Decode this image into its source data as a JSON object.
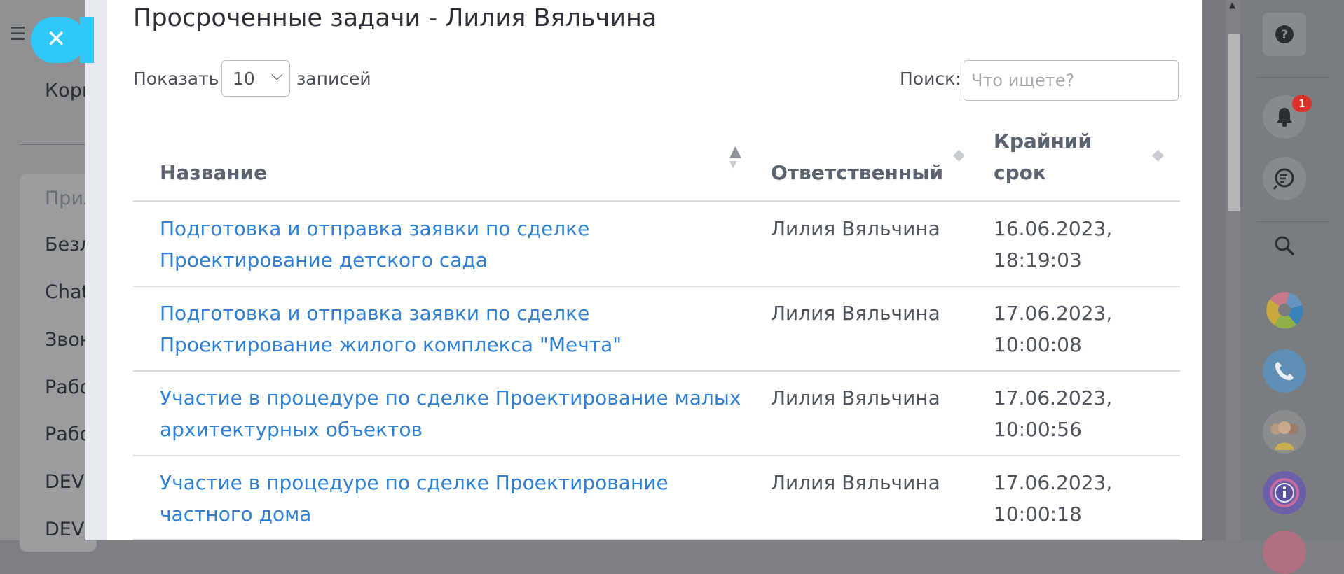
{
  "background": {
    "items": [
      "Корп",
      "Прил",
      "Безл",
      "Chat",
      "Звон",
      "Рабо",
      "Рабо",
      "DEV",
      "DEV"
    ]
  },
  "modal": {
    "title": "Просроченные задачи - Лилия Вяльчина",
    "length": {
      "prefix": "Показать",
      "value": "10",
      "suffix": "записей"
    },
    "search": {
      "label": "Поиск:",
      "placeholder": "Что ищете?"
    },
    "columns": [
      {
        "label": "Название"
      },
      {
        "label": "Ответственный"
      },
      {
        "label_line1": "Крайний",
        "label_line2": "срок"
      }
    ],
    "rows": [
      {
        "name_line1": "Подготовка и отправка заявки по сделке",
        "name_line2": "Проектирование детского сада",
        "responsible": "Лилия Вяльчина",
        "date": "16.06.2023,",
        "time": "18:19:03"
      },
      {
        "name_line1": "Подготовка и отправка заявки по сделке",
        "name_line2": "Проектирование жилого комплекса \"Мечта\"",
        "responsible": "Лилия Вяльчина",
        "date": "17.06.2023,",
        "time": "10:00:08"
      },
      {
        "name_line1": "Участие в процедуре по сделке Проектирование малых",
        "name_line2": "архитектурных объектов",
        "responsible": "Лилия Вяльчина",
        "date": "17.06.2023,",
        "time": "10:00:56"
      },
      {
        "name_line1": "Участие в процедуре по сделке Проектирование",
        "name_line2": "частного дома",
        "responsible": "Лилия Вяльчина",
        "date": "17.06.2023,",
        "time": "10:00:18"
      }
    ]
  },
  "rail": {
    "notification_count": "1",
    "icons": [
      "help-icon",
      "bell-icon",
      "chat-search-icon",
      "search-icon",
      "logo-icon",
      "phone-icon",
      "team-avatar",
      "info-icon"
    ]
  },
  "colors": {
    "link": "#2f80d2",
    "close_button": "#2fc7f7",
    "badge": "#d9322b"
  }
}
